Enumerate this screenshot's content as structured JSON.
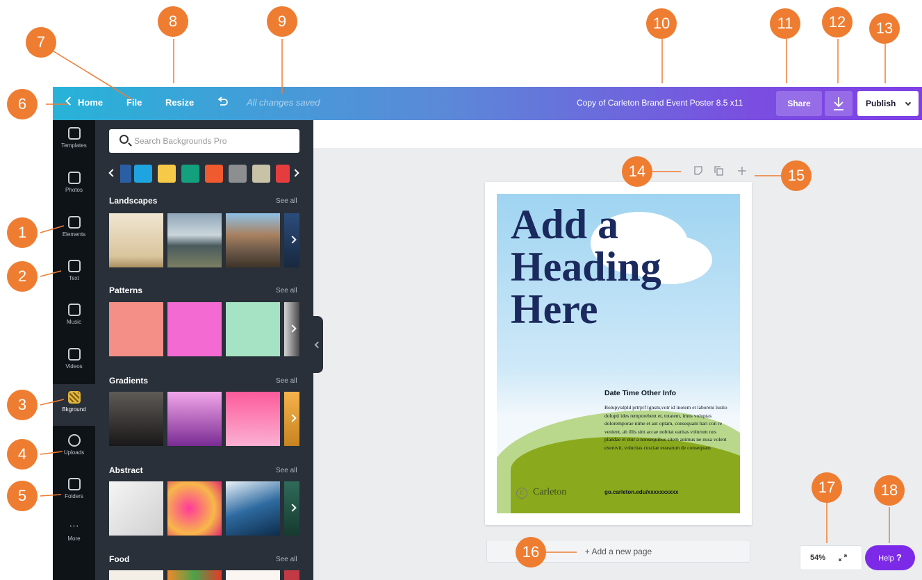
{
  "topbar": {
    "home_label": "Home",
    "file_label": "File",
    "resize_label": "Resize",
    "status": "All changes saved",
    "document_title": "Copy of Carleton Brand Event Poster 8.5 x11",
    "share_label": "Share",
    "publish_label": "Publish",
    "gradient_colors": [
      "#27b3d8",
      "#7f3fe6"
    ]
  },
  "rail": {
    "items": [
      {
        "label": "Templates",
        "icon": "templates-icon"
      },
      {
        "label": "Photos",
        "icon": "photos-icon"
      },
      {
        "label": "Elements",
        "icon": "elements-icon"
      },
      {
        "label": "Text",
        "icon": "text-icon"
      },
      {
        "label": "Music",
        "icon": "music-icon"
      },
      {
        "label": "Videos",
        "icon": "videos-icon"
      },
      {
        "label": "Bkground",
        "icon": "background-icon",
        "active": true
      },
      {
        "label": "Uploads",
        "icon": "uploads-icon"
      },
      {
        "label": "Folders",
        "icon": "folders-icon"
      },
      {
        "label": "More",
        "icon": "more-icon"
      }
    ]
  },
  "panel": {
    "search_placeholder": "Search Backgrounds Pro",
    "swatches": [
      "#2a5fa5",
      "#1ea4e0",
      "#f7c948",
      "#12a07d",
      "#ef5a2e",
      "#8c8e90",
      "#c8c2a7",
      "#e53d3d"
    ],
    "sections": [
      {
        "title": "Landscapes",
        "see_all": "See all"
      },
      {
        "title": "Patterns",
        "see_all": "See all"
      },
      {
        "title": "Gradients",
        "see_all": "See all"
      },
      {
        "title": "Abstract",
        "see_all": "See all"
      },
      {
        "title": "Food",
        "see_all": "See all"
      }
    ]
  },
  "poster": {
    "heading_line1": "Add a",
    "heading_line2": "Heading",
    "heading_line3": "Here",
    "date_line": "Date Time Other Info",
    "body_text": "Bolupysdpld prtrprf lgnsm,votr id inotem et laboreni lustio dolupti ides remporehent et, totatem, imus voluptas doloremporae nime et aut optam, consequam hari con re venient, ab illis sim accae nobitat earitas volurum nos plandae et etur a nonsequibus sitem animus ne nusa volent exerovit, voluritas cusciae essearum de consequam",
    "logo_text": "Carleton",
    "url": "go.carleton.edu/xxxxxxxxxx"
  },
  "canvas": {
    "add_page_label": "+ Add a new page",
    "zoom_level": "54%",
    "help_label": "Help",
    "help_mark": "?"
  },
  "callouts": [
    "1",
    "2",
    "3",
    "4",
    "5",
    "6",
    "7",
    "8",
    "9",
    "10",
    "11",
    "12",
    "13",
    "14",
    "15",
    "16",
    "17",
    "18"
  ]
}
